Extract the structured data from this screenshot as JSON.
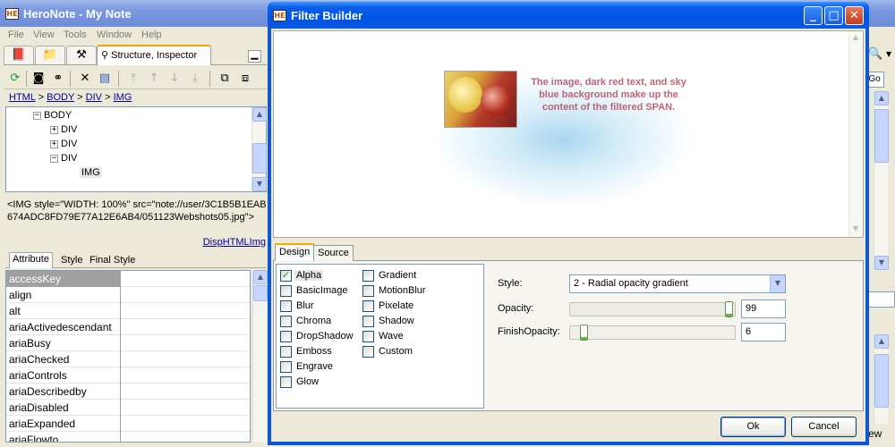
{
  "main_window": {
    "title": "HeroNote - My Note",
    "menu": [
      "File",
      "View",
      "Tools",
      "Window",
      "Help"
    ],
    "icon_tabs": [
      "book-icon",
      "folder-icon",
      "tools-icon"
    ],
    "active_tab_label": "Structure, Inspector",
    "min_button": "▁",
    "breadcrumb": [
      "HTML",
      "BODY",
      "DIV",
      "IMG"
    ],
    "breadcrumb_sep": ">",
    "tree": [
      {
        "label": "BODY",
        "expander": "−"
      },
      {
        "label": "DIV",
        "expander": "+"
      },
      {
        "label": "DIV",
        "expander": "+"
      },
      {
        "label": "DIV",
        "expander": "−"
      },
      {
        "label": "IMG",
        "expander": ""
      }
    ],
    "source_text": "<IMG style=\"WIDTH: 100%\" src=\"note://user/3C1B5B1EAB674ADC8FD79E77A12E6AB4/051123Webshots05.jpg\">",
    "disp_link": "DispHTMLImg",
    "sub_tabs": [
      "Attribute",
      "Style",
      "Final Style"
    ],
    "attributes": [
      "accessKey",
      "align",
      "alt",
      "ariaActivedescendant",
      "ariaBusy",
      "ariaChecked",
      "ariaControls",
      "ariaDescribedby",
      "ariaDisabled",
      "ariaExpanded",
      "ariaFlowto"
    ],
    "right_partial_label": "ew",
    "right_partial_btn": "Go"
  },
  "dialog": {
    "title": "Filter Builder",
    "preview_text": "The image, dark red text, and sky blue background make up the content of the filtered SPAN.",
    "tabs": [
      "Design",
      "Source"
    ],
    "filters_col1": [
      {
        "label": "Alpha",
        "checked": true
      },
      {
        "label": "BasicImage",
        "checked": false
      },
      {
        "label": "Blur",
        "checked": false
      },
      {
        "label": "Chroma",
        "checked": false
      },
      {
        "label": "DropShadow",
        "checked": false
      },
      {
        "label": "Emboss",
        "checked": false
      },
      {
        "label": "Engrave",
        "checked": false
      },
      {
        "label": "Glow",
        "checked": false
      }
    ],
    "filters_col2": [
      {
        "label": "Gradient",
        "checked": false
      },
      {
        "label": "MotionBlur",
        "checked": false
      },
      {
        "label": "Pixelate",
        "checked": false
      },
      {
        "label": "Shadow",
        "checked": false
      },
      {
        "label": "Wave",
        "checked": false
      },
      {
        "label": "Custom",
        "checked": false
      }
    ],
    "style_label": "Style:",
    "style_value": "2 - Radial opacity gradient",
    "opacity_label": "Opacity:",
    "opacity_value": "99",
    "opacity_fraction": 0.99,
    "finish_opacity_label": "FinishOpacity:",
    "finish_opacity_value": "6",
    "finish_opacity_fraction": 0.06,
    "ok_label": "Ok",
    "cancel_label": "Cancel"
  },
  "colors": {
    "main_titlebar": "#7a96df",
    "dialog_titlebar": "#0054e3",
    "preview_text": "#b9485c",
    "preview_glow": "#a9d6ee",
    "link": "#00009c"
  }
}
